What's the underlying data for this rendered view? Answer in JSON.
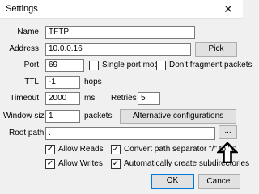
{
  "window": {
    "title": "Settings",
    "close_glyph": "✕"
  },
  "form": {
    "name_label": "Name",
    "name_value": "TFTP",
    "address_label": "Address",
    "address_value": "10.0.0.16",
    "pick_button": "Pick",
    "port_label": "Port",
    "port_value": "69",
    "single_port_label": "Single port mode",
    "dont_fragment_label": "Don't fragment packets",
    "ttl_label": "TTL",
    "ttl_value": "-1",
    "ttl_unit": "hops",
    "timeout_label": "Timeout",
    "timeout_value": "2000",
    "timeout_unit": "ms",
    "retries_label": "Retries",
    "retries_value": "5",
    "window_size_label": "Window size",
    "window_size_value": "1",
    "window_size_unit": "packets",
    "alt_config_button": "Alternative configurations",
    "root_path_label": "Root path",
    "root_path_value": ".",
    "browse_button": "..."
  },
  "options": {
    "allow_reads": {
      "label": "Allow Reads",
      "checked": true
    },
    "convert_path": {
      "label": "Convert path separator \"/\" to \"\\\"",
      "checked": true
    },
    "allow_writes": {
      "label": "Allow Writes",
      "checked": true
    },
    "auto_subdirs": {
      "label": "Automatically create subdirectories",
      "checked": true
    },
    "single_port": {
      "checked": false
    },
    "dont_fragment": {
      "checked": false
    },
    "check_glyph": "✓"
  },
  "footer": {
    "ok_button": "OK",
    "cancel_button": "Cancel"
  }
}
